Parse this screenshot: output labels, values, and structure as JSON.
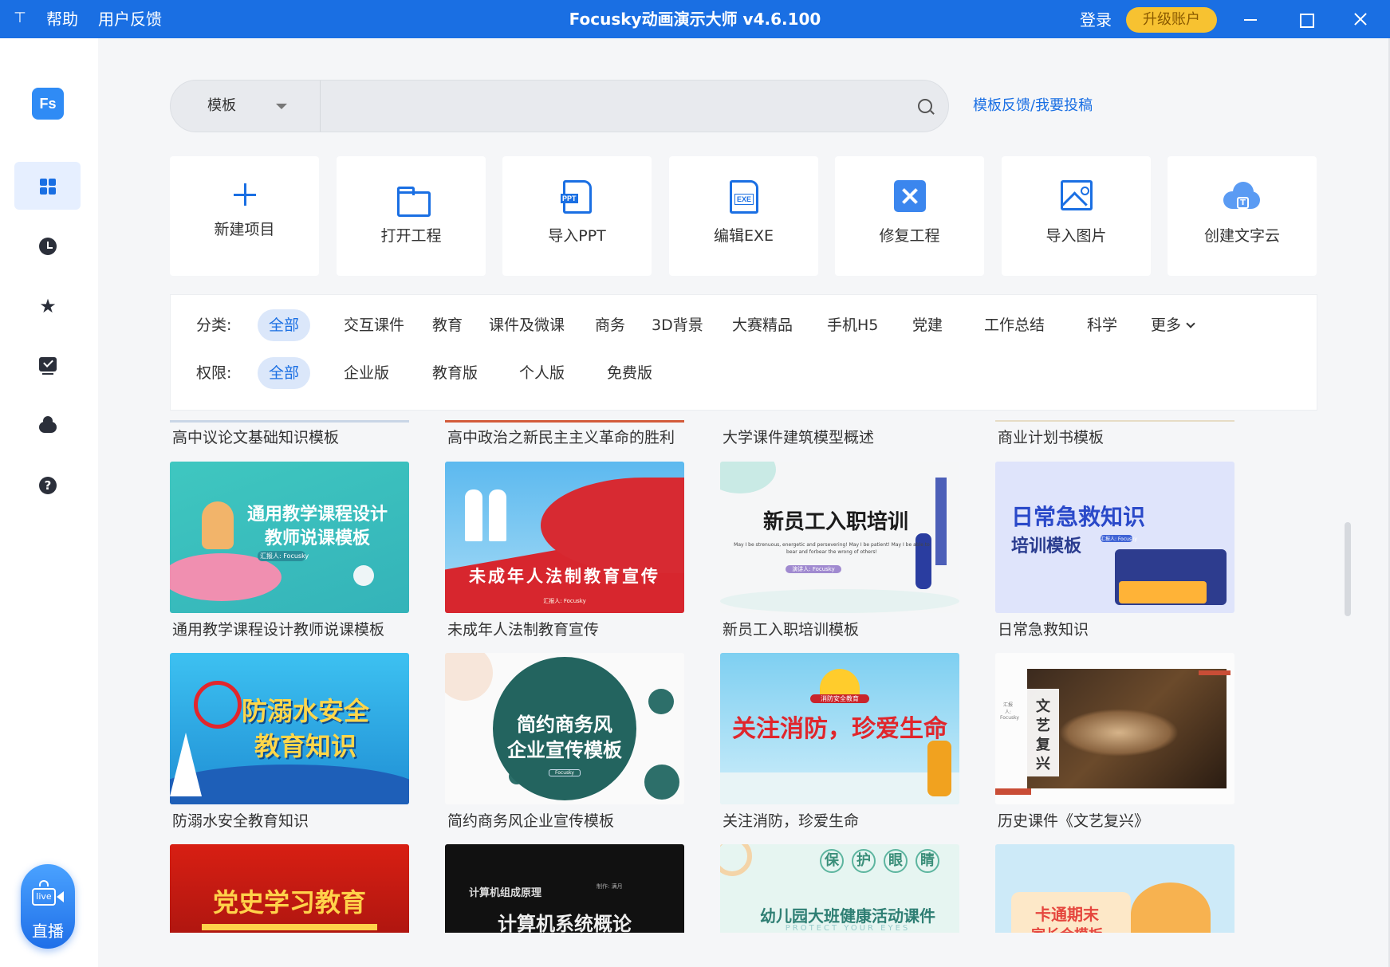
{
  "titlebar": {
    "pin_icon": "pin-icon",
    "help": "帮助",
    "feedback": "用户反馈",
    "title": "Focusky动画演示大师 v4.6.100",
    "login": "登录",
    "upgrade": "升级账户",
    "accent": "#1a6fe3"
  },
  "sidebar": {
    "logo": "Fs",
    "items": [
      {
        "icon": "grid-icon",
        "active": true
      },
      {
        "icon": "clock-icon"
      },
      {
        "icon": "star-icon"
      },
      {
        "icon": "monitor-check-icon"
      },
      {
        "icon": "cloud-icon"
      },
      {
        "icon": "help-icon"
      }
    ],
    "live_label": "直播",
    "live_badge": "live"
  },
  "search": {
    "type_label": "模板",
    "placeholder": "",
    "value": "",
    "feedback_link": "模板反馈/我要投稿"
  },
  "actions": [
    {
      "label": "新建项目",
      "icon": "plus-icon"
    },
    {
      "label": "打开工程",
      "icon": "folder-open-icon"
    },
    {
      "label": "导入PPT",
      "icon": "ppt-file-icon",
      "badge": "PPT"
    },
    {
      "label": "编辑EXE",
      "icon": "exe-file-icon",
      "badge": "EXE"
    },
    {
      "label": "修复工程",
      "icon": "repair-tools-icon"
    },
    {
      "label": "导入图片",
      "icon": "image-icon"
    },
    {
      "label": "创建文字云",
      "icon": "word-cloud-icon",
      "badge": "T"
    }
  ],
  "filters": {
    "category_label": "分类:",
    "categories": [
      "全部",
      "交互课件",
      "教育",
      "课件及微课",
      "商务",
      "3D背景",
      "大赛精品",
      "手机H5",
      "党建",
      "工作总结",
      "科学"
    ],
    "more": "更多",
    "permission_label": "权限:",
    "permissions": [
      "全部",
      "企业版",
      "教育版",
      "个人版",
      "免费版"
    ]
  },
  "templates": {
    "row0": [
      "高中议论文基础知识模板",
      "高中政治之新民主主义革命的胜利",
      "大学课件建筑模型概述",
      "商业计划书模板"
    ],
    "row1": [
      {
        "title": "通用教学课程设计教师说课模板",
        "thumb_lines": [
          "通用教学课程设计",
          "教师说课模板"
        ],
        "thumb_sub": "汇报人: Focusky"
      },
      {
        "title": "未成年人法制教育宣传",
        "thumb_lines": [
          "未成年人法制教育宣传"
        ],
        "thumb_sub": "汇报人: Focusky"
      },
      {
        "title": "新员工入职培训模板",
        "thumb_lines": [
          "新员工入职培训"
        ],
        "thumb_sub": "May I be strenuous, energetic and persevering! May I be patient! May I be able to bear and forbear the wrong of others!",
        "thumb_sub2": "演讲人: Focusky"
      },
      {
        "title": "日常急救知识",
        "thumb_lines": [
          "日常急救知识",
          "培训模板"
        ],
        "thumb_sub": "汇报人: Focusky"
      }
    ],
    "row2": [
      {
        "title": "防溺水安全教育知识",
        "thumb_lines": [
          "防溺水安全",
          "教育知识"
        ]
      },
      {
        "title": "简约商务风企业宣传模板",
        "thumb_lines": [
          "简约商务风",
          "企业宣传模板"
        ],
        "thumb_sub": "Focusky"
      },
      {
        "title": "关注消防，珍爱生命",
        "thumb_lines": [
          "关注消防，珍爱生命"
        ],
        "thumb_badge": "消防安全教育"
      },
      {
        "title": "历史课件《文艺复兴》",
        "thumb_lines": [
          "文艺复兴"
        ],
        "thumb_sub": "汇报人: Focusky"
      }
    ],
    "row3": [
      {
        "thumb_lines": [
          "党史学习教育"
        ]
      },
      {
        "thumb_lines": [
          "计算机组成原理",
          "计算机系统概论"
        ],
        "thumb_sub": "制作: 满月"
      },
      {
        "thumb_lines": [
          "保",
          "护",
          "眼",
          "睛",
          "幼儿园大班健康活动课件"
        ],
        "thumb_sub": "PROTECT YOUR EYES"
      },
      {
        "thumb_lines": [
          "卡通期末",
          "家长会模板"
        ]
      }
    ]
  }
}
